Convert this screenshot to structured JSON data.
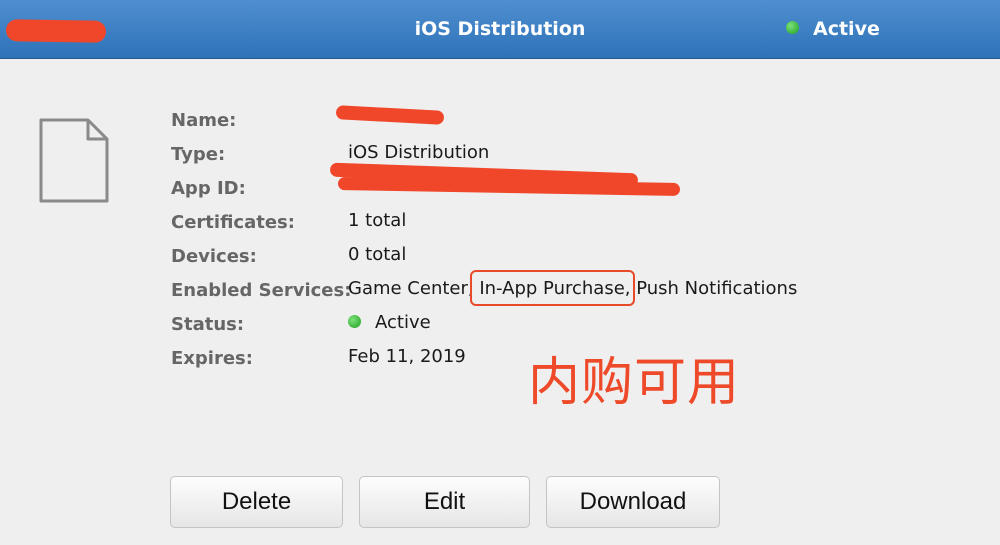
{
  "header": {
    "title": "iOS Distribution",
    "status": "Active"
  },
  "details": {
    "rows": [
      {
        "label": "Name:",
        "value": ""
      },
      {
        "label": "Type:",
        "value": "iOS Distribution"
      },
      {
        "label": "App ID:",
        "value": ""
      },
      {
        "label": "Certificates:",
        "value": "1 total"
      },
      {
        "label": "Devices:",
        "value": "0 total"
      },
      {
        "label": "Enabled Services:",
        "value": "Game Center, In-App Purchase, Push Notifications"
      },
      {
        "label": "Status:",
        "value": "Active"
      },
      {
        "label": "Expires:",
        "value": "Feb 11, 2019"
      }
    ]
  },
  "annotation": "内购可用",
  "buttons": {
    "delete": "Delete",
    "edit": "Edit",
    "download": "Download"
  },
  "colors": {
    "header_blue": "#3a7cc2",
    "status_green": "#2db52d",
    "annotation_red": "#ee4a2a"
  },
  "icons": {
    "document": "document-icon",
    "status": "status-dot-icon"
  }
}
